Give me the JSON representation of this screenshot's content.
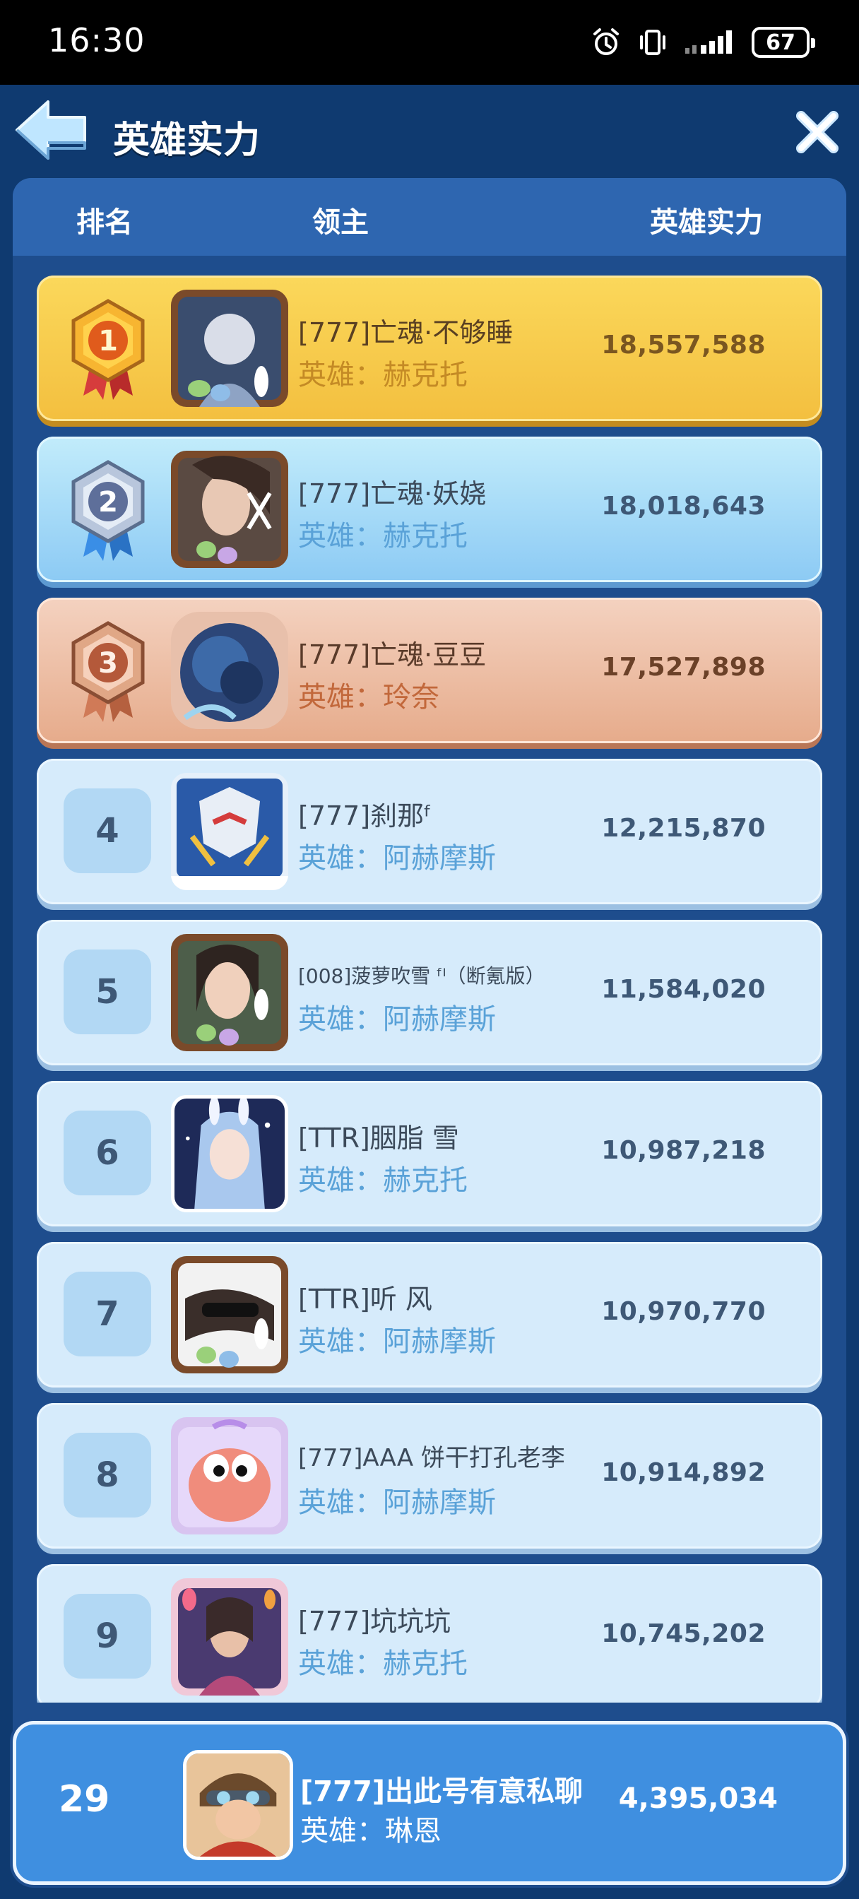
{
  "status_bar": {
    "time": "16:30",
    "battery": "67",
    "icons": [
      "alarm-icon",
      "vibrate-icon",
      "signal-icon",
      "battery-icon"
    ]
  },
  "header": {
    "title": "英雄实力",
    "back_icon": "back-arrow-icon",
    "close_icon": "close-icon"
  },
  "columns": {
    "rank": "排名",
    "lord": "领主",
    "power": "英雄实力"
  },
  "rankings": [
    {
      "rank": "1",
      "name": "[777]亡魂·不够睡",
      "hero": "英雄：赫克托",
      "power": "18,557,588",
      "tier": "gold"
    },
    {
      "rank": "2",
      "name": "[777]亡魂·妖娆",
      "hero": "英雄：赫克托",
      "power": "18,018,643",
      "tier": "silver"
    },
    {
      "rank": "3",
      "name": "[777]亡魂·豆豆",
      "hero": "英雄：玲奈",
      "power": "17,527,898",
      "tier": "bronze"
    },
    {
      "rank": "4",
      "name": "[777]刹那ᶠ",
      "hero": "英雄：阿赫摩斯",
      "power": "12,215,870",
      "tier": "normal"
    },
    {
      "rank": "5",
      "name": "[008]菠萝吹雪 ᶠᴵ（断氪版）",
      "hero": "英雄：阿赫摩斯",
      "power": "11,584,020",
      "tier": "normal"
    },
    {
      "rank": "6",
      "name": "[TTR]胭脂 雪",
      "hero": "英雄：赫克托",
      "power": "10,987,218",
      "tier": "normal"
    },
    {
      "rank": "7",
      "name": "[TTR]听 风",
      "hero": "英雄：阿赫摩斯",
      "power": "10,970,770",
      "tier": "normal"
    },
    {
      "rank": "8",
      "name": "[777]AAA 饼干打孔老李",
      "hero": "英雄：阿赫摩斯",
      "power": "10,914,892",
      "tier": "normal"
    },
    {
      "rank": "9",
      "name": "[777]坑坑坑",
      "hero": "英雄：赫克托",
      "power": "10,745,202",
      "tier": "normal"
    }
  ],
  "my_rank": {
    "rank": "29",
    "name": "[777]出此号有意私聊",
    "hero": "英雄：琳恩",
    "power": "4,395,034"
  }
}
